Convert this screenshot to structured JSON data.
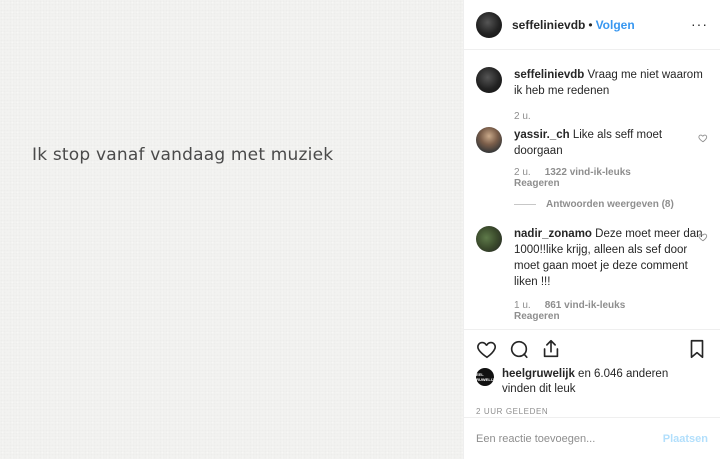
{
  "post": {
    "image_text": "Ik stop vanaf vandaag met muziek"
  },
  "header": {
    "username": "seffelinievdb",
    "separator": "•",
    "follow_label": "Volgen",
    "more_label": "···"
  },
  "caption": {
    "username": "seffelinievdb",
    "text": "Vraag me niet waarom ik heb me redenen",
    "time": "2 u."
  },
  "comments": [
    {
      "username": "yassir._ch",
      "text": "Like als seff moet doorgaan",
      "time": "2 u.",
      "likes": "1322 vind-ik-leuks",
      "reply": "Reageren",
      "view_replies": "Antwoorden weergeven (8)"
    },
    {
      "username": "nadir_zonamo",
      "text": "Deze moet meer dan 1000!!like krijg, alleen als sef door moet gaan moet je deze comment liken !!!",
      "time": "1 u.",
      "likes": "861 vind-ik-leuks",
      "reply": "Reageren"
    }
  ],
  "likes": {
    "avatar_text": "HEEL GRUWELIJK",
    "text_user": "heelgruwelijk",
    "text_rest": " en 6.046 anderen",
    "text_line2": "vinden dit leuk"
  },
  "timestamp": "2 UUR GELEDEN",
  "add_comment": {
    "placeholder": "Een reactie toevoegen...",
    "post_label": "Plaatsen"
  },
  "colors": {
    "accent": "#3897f0",
    "muted": "#8e8e8e",
    "post_disabled": "#b2dffc"
  }
}
